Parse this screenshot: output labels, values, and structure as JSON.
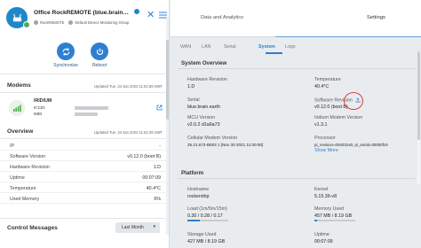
{
  "device": {
    "title": "Office RockREMOTE (blue.brain…",
    "chip_1": "RockREMOTE",
    "chip_2": "Default Device Monitoring Group",
    "close_glyph": "✕"
  },
  "actions": [
    {
      "label": "Synchronise",
      "icon": "sync-icon"
    },
    {
      "label": "Reboot",
      "icon": "power-icon"
    }
  ],
  "modems": {
    "title": "Modems",
    "updated": "Updated Tue, 24 Jan 2023 11:52:59 GMT",
    "name": "IRIDIUM",
    "iccid_label": "ICCID",
    "imei_label": "IMEI"
  },
  "overview": {
    "title": "Overview",
    "updated": "Updated Tue, 24 Jan 2023 11:52:39 GMT",
    "rows": [
      {
        "key": "IP",
        "value": "-"
      },
      {
        "key": "Software Version",
        "value": "v0.12.0 (boot B)"
      },
      {
        "key": "Hardware Revision",
        "value": "1.D"
      },
      {
        "key": "Uptime",
        "value": "00:07:09"
      },
      {
        "key": "Temperature",
        "value": "40.4°C"
      },
      {
        "key": "Used Memory",
        "value": "6%"
      }
    ]
  },
  "control": {
    "title": "Control Messages",
    "select_value": "Last Month",
    "chevron": "▾"
  },
  "top_tabs": [
    {
      "label": "Data and Analytics",
      "active": false
    },
    {
      "label": "Settings",
      "active": true
    }
  ],
  "sub_tabs": [
    {
      "label": "WAN"
    },
    {
      "label": "LAN"
    },
    {
      "label": "Serial"
    },
    {
      "label": "System",
      "active": true
    },
    {
      "label": "Logs"
    }
  ],
  "system_overview": {
    "title": "System Overview",
    "fields": {
      "hw_rev_k": "Hardware Revision",
      "hw_rev_v": "1.D",
      "temp_k": "Temperature",
      "temp_v": "40.4°C",
      "serial_k": "Serial",
      "serial_v": "blue.brain.earth",
      "sw_rev_k": "Software Revision",
      "sw_rev_v": "v0.12.0 (boot B)",
      "mcu_k": "MCU Version",
      "mcu_v": "v2.0.2 d1a6a73",
      "iridium_k": "Iridium Modem Version",
      "iridium_v": "v1.3.1",
      "cell_k": "Cellular Modem Version",
      "cell_v": "25.21.672-B003 1 [Nov 30 2021 11:00:00]",
      "proc_k": "Processor",
      "proc_v": "pi_revision=00403140, pi_serial=00000fc9",
      "show_more": "Show More"
    }
  },
  "platform": {
    "title": "Platform",
    "fields": {
      "host_k": "Hostname",
      "host_v": "rockership",
      "kernel_k": "Kernel",
      "kernel_v": "5.15.36-v8",
      "load_k": "Load (1m/5m/15m)",
      "load_v": "0.30 / 0.28 / 0.17",
      "mem_k": "Memory Used",
      "mem_v": "457 MB / 8.19 GB",
      "storage_k": "Storage Used",
      "storage_v": "427 MB / 8.19 GB",
      "uptime_k": "Uptime",
      "uptime_v": "00:07:09"
    },
    "load_fraction": 0.3,
    "memory_fraction": 0.06,
    "storage_fraction": 0.05
  },
  "colors": {
    "accent": "#2f7fd0",
    "online": "#4caf50",
    "highlight": "#e0383e"
  }
}
